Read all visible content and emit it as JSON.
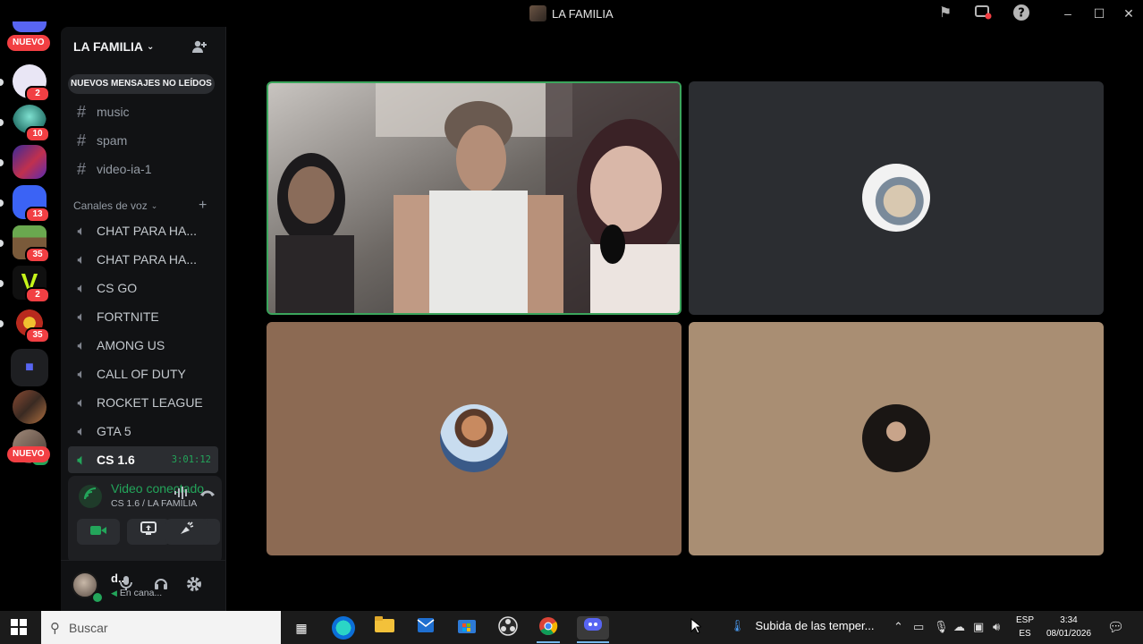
{
  "window": {
    "title": "LA FAMILIA",
    "controls": {
      "minimize": "–",
      "maximize": "☐",
      "close": "✕"
    }
  },
  "rail": {
    "nuevo_top": "NUEVO",
    "nuevo_bottom": "NUEVO",
    "servers": [
      {
        "name": "server-1",
        "badge": "2",
        "color": "#e9e6f5"
      },
      {
        "name": "server-2",
        "badge": "10",
        "color": "#3a8f8c"
      },
      {
        "name": "server-3",
        "badge": "",
        "color": "#6a3fb3"
      },
      {
        "name": "server-4",
        "badge": "13",
        "color": "#3b63f5"
      },
      {
        "name": "server-5",
        "badge": "35",
        "color": "#5e9a3c"
      },
      {
        "name": "server-6",
        "badge": "2",
        "color": "#101010"
      },
      {
        "name": "server-7",
        "badge": "35",
        "color": "#a8241e"
      },
      {
        "name": "folder",
        "badge": "",
        "color": "#1e1f22"
      },
      {
        "name": "server-8",
        "badge": "",
        "color": "#6e3e2a"
      },
      {
        "name": "server-9",
        "badge": "",
        "color": "#6f5f54"
      }
    ]
  },
  "sidebar": {
    "guild_name": "LA FAMILIA",
    "unread_banner": "NUEVOS MENSAJES NO LEÍDOS",
    "text_channels": [
      "music",
      "spam",
      "video-ia-1"
    ],
    "voice_category": "Canales de voz",
    "voice_channels": [
      "CHAT PARA HA...",
      "CHAT PARA HA...",
      "CS GO",
      "FORTNITE",
      "AMONG US",
      "CALL OF DUTY",
      "ROCKET LEAGUE",
      "GTA 5"
    ],
    "active_channel": {
      "name": "CS 1.6",
      "timer": "3:01:12"
    }
  },
  "voice_panel": {
    "status": "Video conectado",
    "subtitle": "CS 1.6 / LA FAMILIA"
  },
  "user_panel": {
    "name": "d...",
    "status": "En cana..."
  },
  "taskbar": {
    "search_placeholder": "Buscar",
    "news": "Subida de las temper...",
    "lang_top": "ESP",
    "lang_bottom": "ES",
    "time": "3:34",
    "date": "08/01/2026"
  },
  "colors": {
    "speaking_border": "#3ba55c",
    "accent_green": "#23a55a",
    "badge_red": "#f23f43"
  }
}
